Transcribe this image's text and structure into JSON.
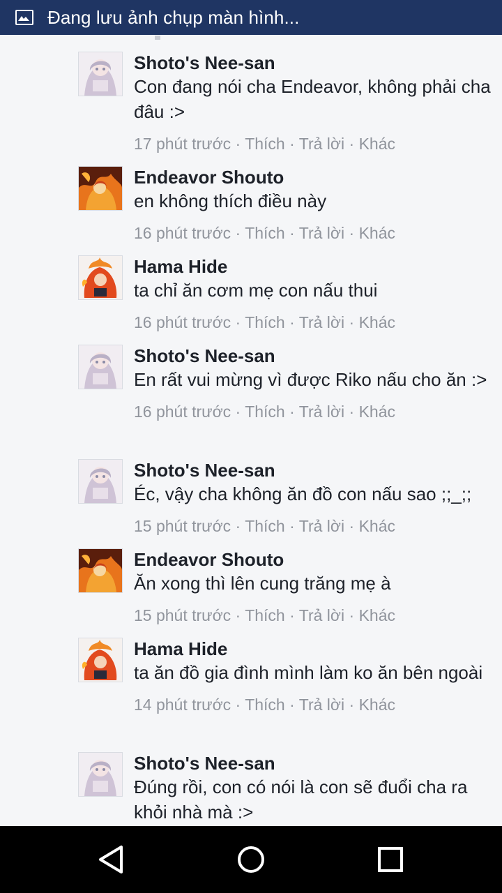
{
  "statusbar": {
    "title": "Đang lưu ảnh chụp màn hình...",
    "icon": "image-icon",
    "bg_color": "#1f3563"
  },
  "comments": [
    {
      "author": "Shoto's Nee-san",
      "avatar": "shoto-nee-san-avatar",
      "text": "Con đang nói cha Endeavor, không phải cha đâu :>",
      "time": "17 phút trước",
      "like": "Thích",
      "reply": "Trả lời",
      "more": "Khác"
    },
    {
      "author": "Endeavor Shouto",
      "avatar": "endeavor-shouto-avatar",
      "text": "en không thích điều này",
      "time": "16 phút trước",
      "like": "Thích",
      "reply": "Trả lời",
      "more": "Khác"
    },
    {
      "author": "Hama Hide",
      "avatar": "hama-hide-avatar",
      "text": "ta chỉ ăn cơm mẹ con nấu thui",
      "time": "16 phút trước",
      "like": "Thích",
      "reply": "Trả lời",
      "more": "Khác"
    },
    {
      "author": "Shoto's Nee-san",
      "avatar": "shoto-nee-san-avatar",
      "text": "En rất vui mừng vì được Riko nấu cho ăn :>",
      "time": "16 phút trước",
      "like": "Thích",
      "reply": "Trả lời",
      "more": "Khác"
    },
    {
      "author": "Shoto's Nee-san",
      "avatar": "shoto-nee-san-avatar",
      "text": "Éc, vậy cha không ăn đồ con nấu sao ;;_;;",
      "time": "15 phút trước",
      "like": "Thích",
      "reply": "Trả lời",
      "more": "Khác"
    },
    {
      "author": "Endeavor Shouto",
      "avatar": "endeavor-shouto-avatar",
      "text": "Ăn xong thì lên cung trăng mẹ à",
      "time": "15 phút trước",
      "like": "Thích",
      "reply": "Trả lời",
      "more": "Khác"
    },
    {
      "author": "Hama Hide",
      "avatar": "hama-hide-avatar",
      "text": "ta ăn đồ gia đình mình làm ko ăn bên ngoài",
      "time": "14 phút trước",
      "like": "Thích",
      "reply": "Trả lời",
      "more": "Khác"
    },
    {
      "author": "Shoto's Nee-san",
      "avatar": "shoto-nee-san-avatar",
      "text": "Đúng rồi, con có nói là con sẽ đuổi cha ra khỏi nhà mà :>",
      "time": "",
      "like": "",
      "reply": "",
      "more": ""
    }
  ],
  "meta_separator": " · ",
  "navbar": {
    "back": "back-icon",
    "home": "home-icon",
    "recents": "recents-icon"
  }
}
